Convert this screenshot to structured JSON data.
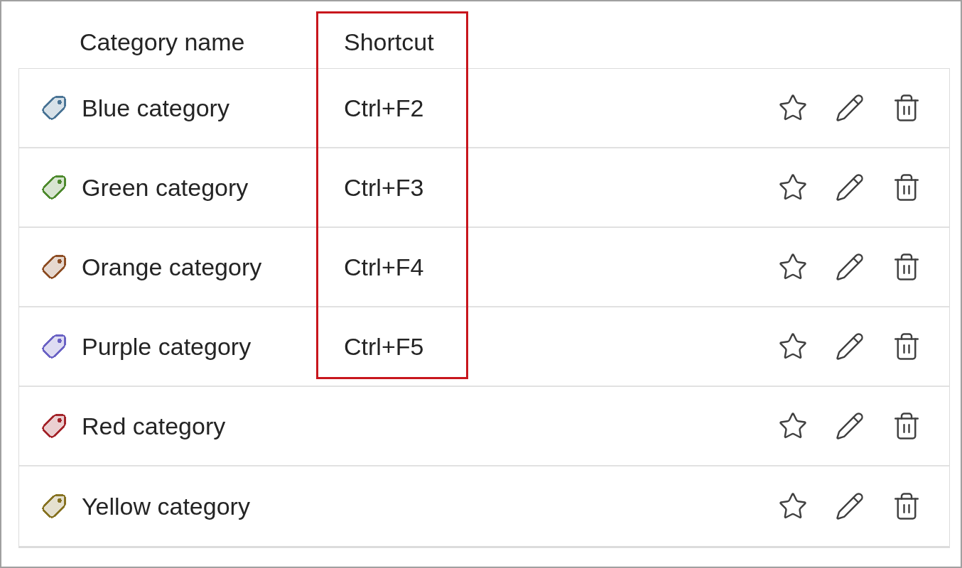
{
  "columns": [
    {
      "label": "Category name",
      "highlighted": false
    },
    {
      "label": "Shortcut",
      "highlighted": true
    }
  ],
  "categories": [
    {
      "name": "Blue category",
      "color": "#4b7596",
      "shortcut": "Ctrl+F2",
      "favorite": false
    },
    {
      "name": "Green category",
      "color": "#4e8a2e",
      "shortcut": "Ctrl+F3",
      "favorite": false
    },
    {
      "name": "Orange category",
      "color": "#8e4f26",
      "shortcut": "Ctrl+F4",
      "favorite": false
    },
    {
      "name": "Purple category",
      "color": "#6a62c4",
      "shortcut": "Ctrl+F5",
      "favorite": false
    },
    {
      "name": "Red category",
      "color": "#a4262c",
      "favorite": false
    },
    {
      "name": "Yellow category",
      "color": "#877323",
      "favorite": false
    }
  ]
}
